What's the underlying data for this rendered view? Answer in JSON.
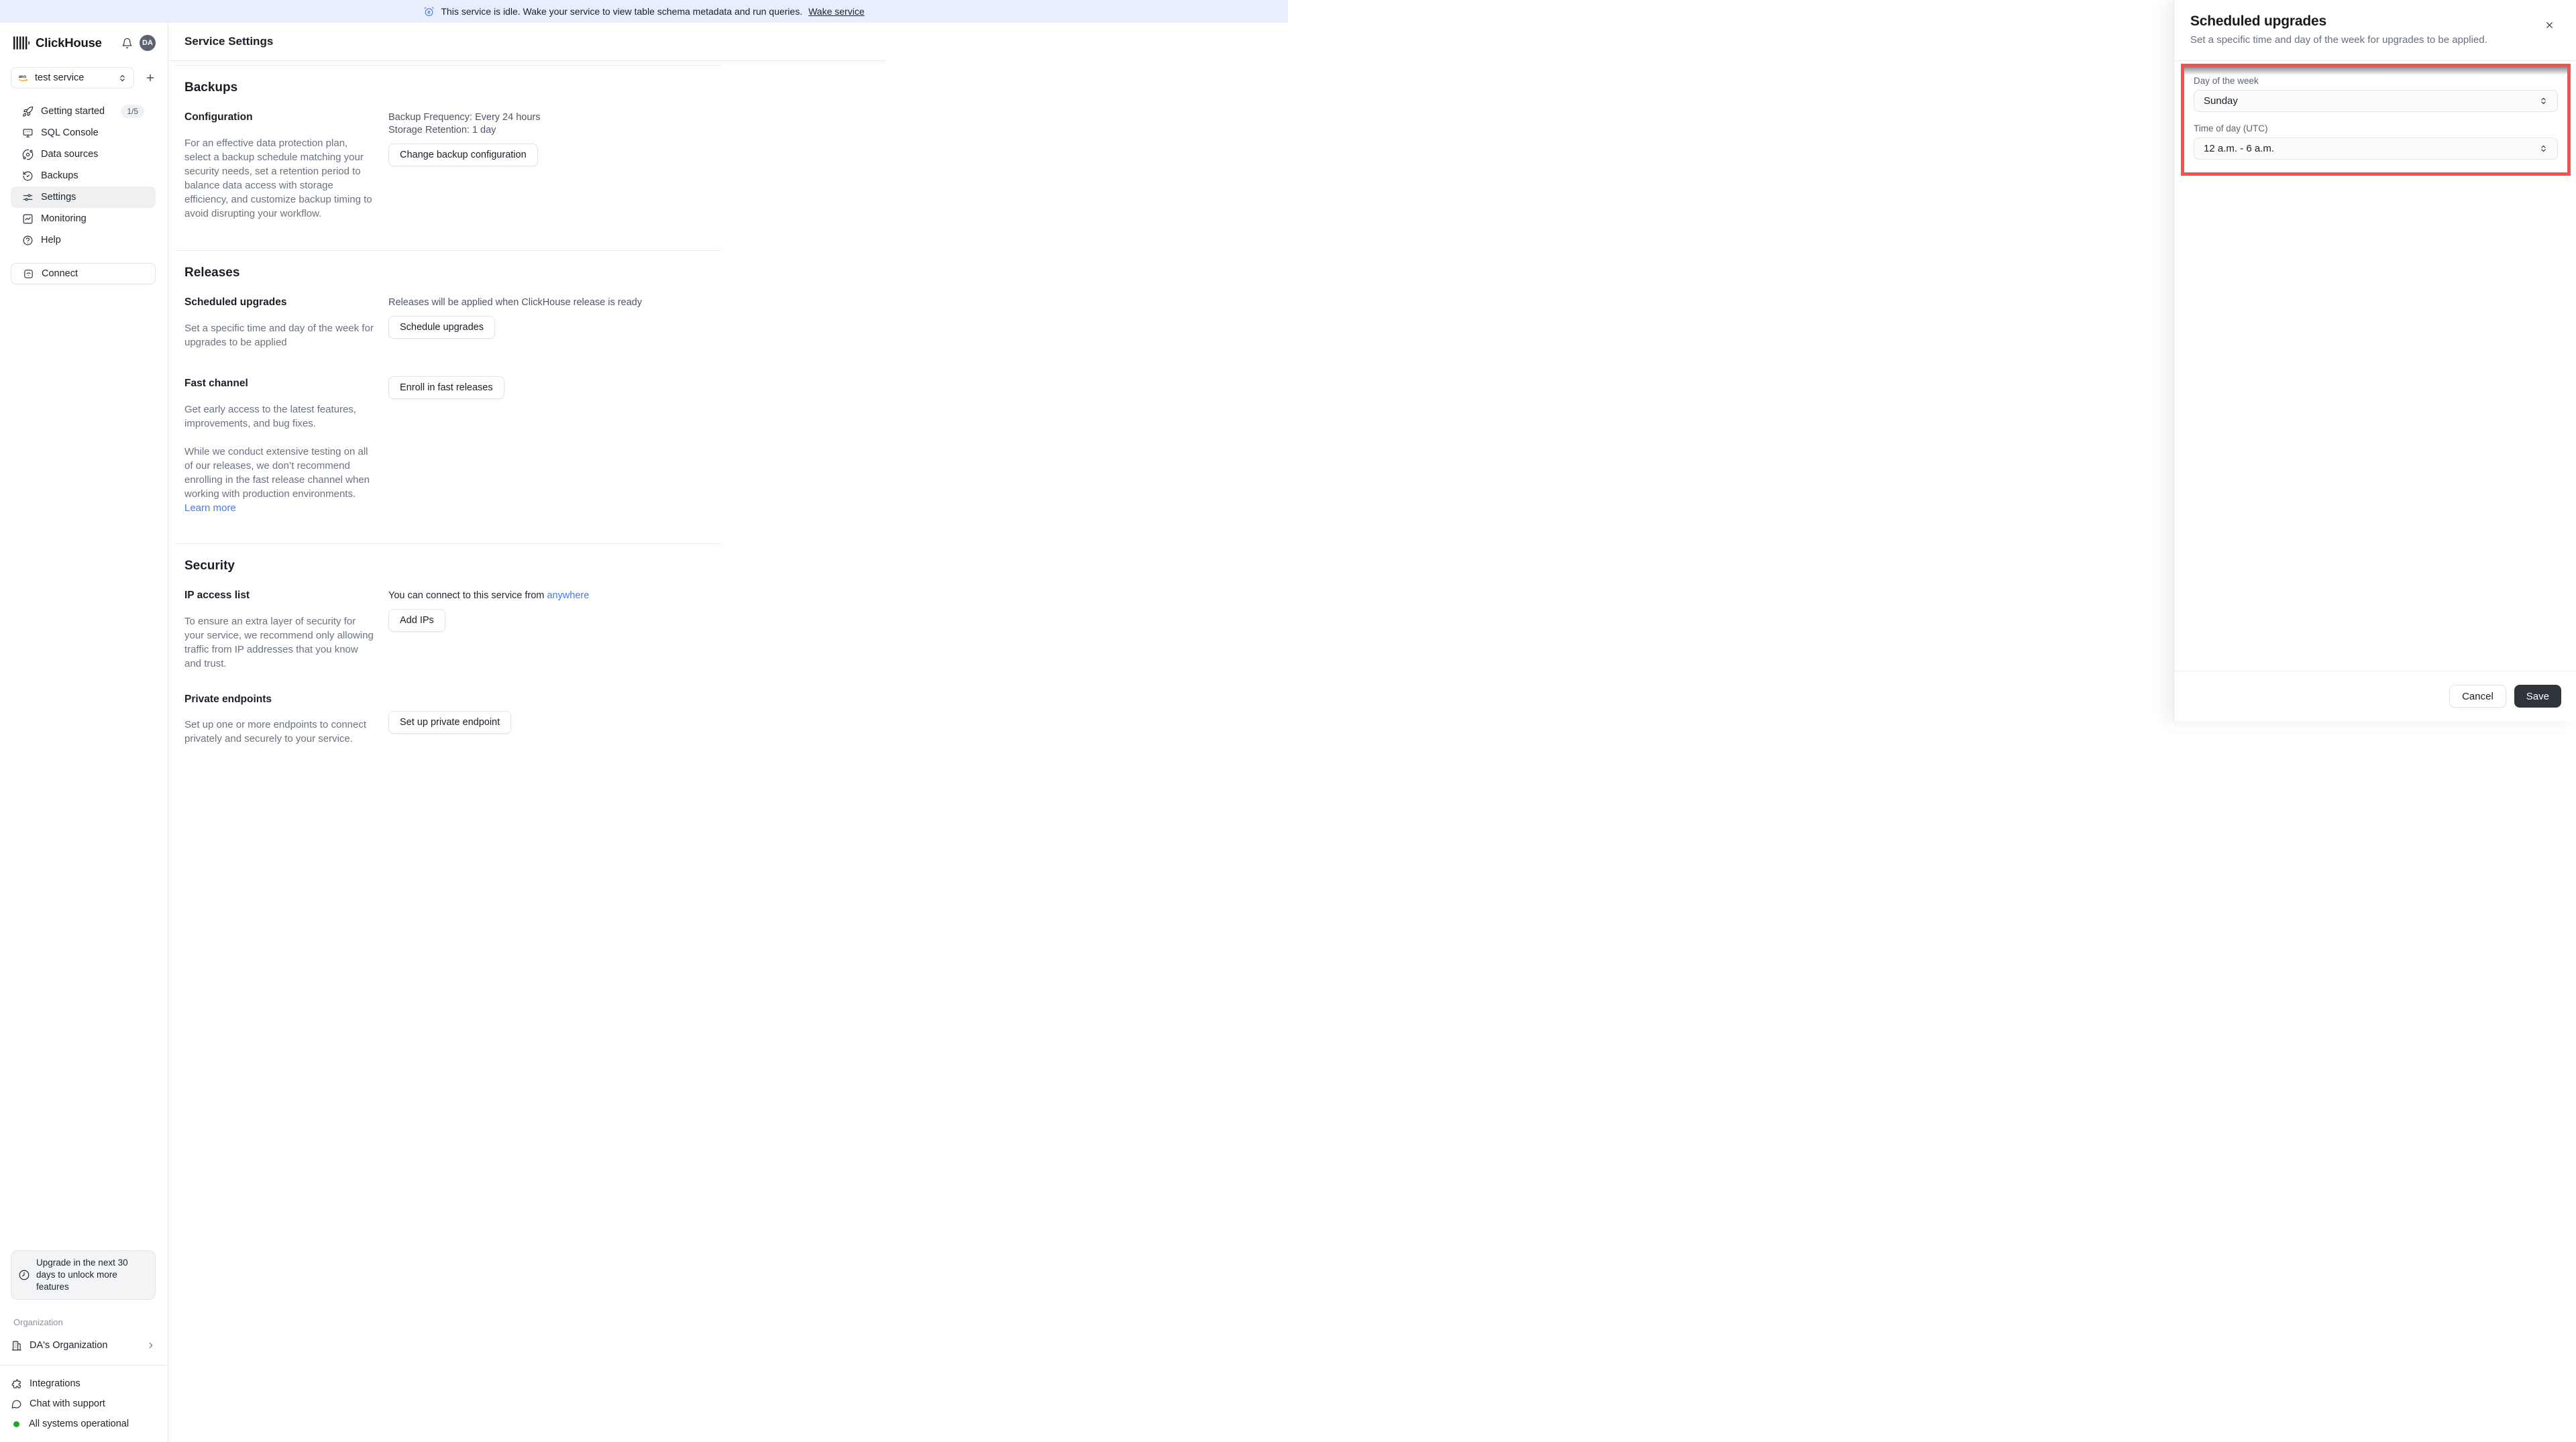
{
  "banner": {
    "text": "This service is idle. Wake your service to view table schema metadata and run queries.",
    "link": "Wake service"
  },
  "sidebar": {
    "logo": "ClickHouse",
    "avatar": "DA",
    "service_selector": {
      "value": "test service",
      "provider": "aws"
    },
    "nav": [
      {
        "label": "Getting started",
        "badge": "1/5"
      },
      {
        "label": "SQL Console"
      },
      {
        "label": "Data sources"
      },
      {
        "label": "Backups"
      },
      {
        "label": "Settings"
      },
      {
        "label": "Monitoring"
      },
      {
        "label": "Help"
      }
    ],
    "connect_label": "Connect",
    "upgrade_note": "Upgrade in the next 30 days to unlock more features",
    "organization_label": "Organization",
    "organization_name": "DA's Organization",
    "footer": [
      {
        "label": "Integrations"
      },
      {
        "label": "Chat with support"
      },
      {
        "label": "All systems operational"
      }
    ]
  },
  "main": {
    "title": "Service Settings",
    "backups": {
      "heading": "Backups",
      "config_label": "Configuration",
      "frequency": "Backup Frequency: Every 24 hours",
      "retention": "Storage Retention: 1 day",
      "button": "Change backup configuration",
      "description": "For an effective data protection plan, select a backup schedule matching your security needs, set a retention period to balance data access with storage efficiency, and customize backup timing to avoid disrupting your workflow."
    },
    "releases": {
      "heading": "Releases",
      "scheduled_label": "Scheduled upgrades",
      "scheduled_info": "Releases will be applied when ClickHouse release is ready",
      "scheduled_button": "Schedule upgrades",
      "scheduled_description": "Set a specific time and day of the week for upgrades to be applied",
      "fast_label": "Fast channel",
      "fast_button": "Enroll in fast releases",
      "fast_description1": "Get early access to the latest features, improvements, and bug fixes.",
      "fast_description2": "While we conduct extensive testing on all of our releases, we don’t recommend enrolling in the fast release channel when working with production environments.",
      "fast_link": "Learn more"
    },
    "security": {
      "heading": "Security",
      "ip_label": "IP access list",
      "ip_info_prefix": "You can connect to this service from",
      "ip_info_link": "anywhere",
      "ip_button": "Add IPs",
      "ip_description": "To ensure an extra layer of security for your service, we recommend only allowing traffic from IP addresses that you know and trust.",
      "private_label": "Private endpoints",
      "private_button": "Set up private endpoint",
      "private_description": "Set up one or more endpoints to connect privately and securely to your service."
    }
  },
  "drawer": {
    "title": "Scheduled upgrades",
    "description": "Set a specific time and day of the week for upgrades to be applied.",
    "day_label": "Day of the week",
    "day_value": "Sunday",
    "time_label": "Time of day (UTC)",
    "time_value": "12 a.m. - 6 a.m.",
    "cancel_label": "Cancel",
    "save_label": "Save"
  },
  "colors": {
    "highlight_red": "#F85349",
    "link_blue": "#447AF3",
    "banner_bg": "#E9EEFC",
    "save_button_bg": "#2F333A",
    "status_green": "#27A32B"
  }
}
